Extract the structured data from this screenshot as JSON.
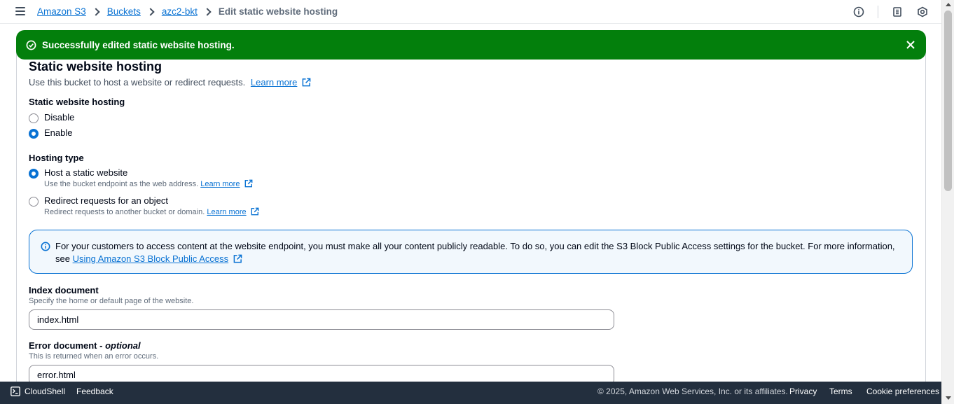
{
  "breadcrumb": {
    "items": [
      "Amazon S3",
      "Buckets",
      "azc2-bkt"
    ],
    "current": "Edit static website hosting"
  },
  "flash": {
    "message": "Successfully edited static website hosting.",
    "color": "#037f0c"
  },
  "section": {
    "title": "Static website hosting",
    "description": "Use this bucket to host a website or redirect requests.",
    "learn_more": "Learn more"
  },
  "hosting": {
    "label": "Static website hosting",
    "options": [
      "Disable",
      "Enable"
    ],
    "selected": "Enable"
  },
  "hosting_type": {
    "label": "Hosting type",
    "options": [
      {
        "label": "Host a static website",
        "description": "Use the bucket endpoint as the web address.",
        "link": "Learn more",
        "selected": true
      },
      {
        "label": "Redirect requests for an object",
        "description": "Redirect requests to another bucket or domain.",
        "link": "Learn more",
        "selected": false
      }
    ]
  },
  "info": {
    "text": "For your customers to access content at the website endpoint, you must make all your content publicly readable. To do so, you can edit the S3 Block Public Access settings for the bucket. For more information, see",
    "link": "Using Amazon S3 Block Public Access"
  },
  "index_document": {
    "label": "Index document",
    "description": "Specify the home or default page of the website.",
    "value": "index.html"
  },
  "error_document": {
    "label": "Error document",
    "optional": "optional",
    "description": "This is returned when an error occurs.",
    "value": "error.html"
  },
  "footer": {
    "cloudshell": "CloudShell",
    "feedback": "Feedback",
    "copyright": "© 2025, Amazon Web Services, Inc. or its affiliates.",
    "privacy": "Privacy",
    "terms": "Terms",
    "cookie": "Cookie preferences"
  },
  "colors": {
    "link": "#0972d3",
    "success": "#037f0c",
    "footer_bg": "#232f3e",
    "info_bg": "#f2f8fd"
  },
  "icons": [
    "menu-icon",
    "info-icon",
    "notes-icon",
    "settings-hex-icon",
    "success-check-icon",
    "close-icon",
    "external-link-icon",
    "cloudshell-icon"
  ]
}
